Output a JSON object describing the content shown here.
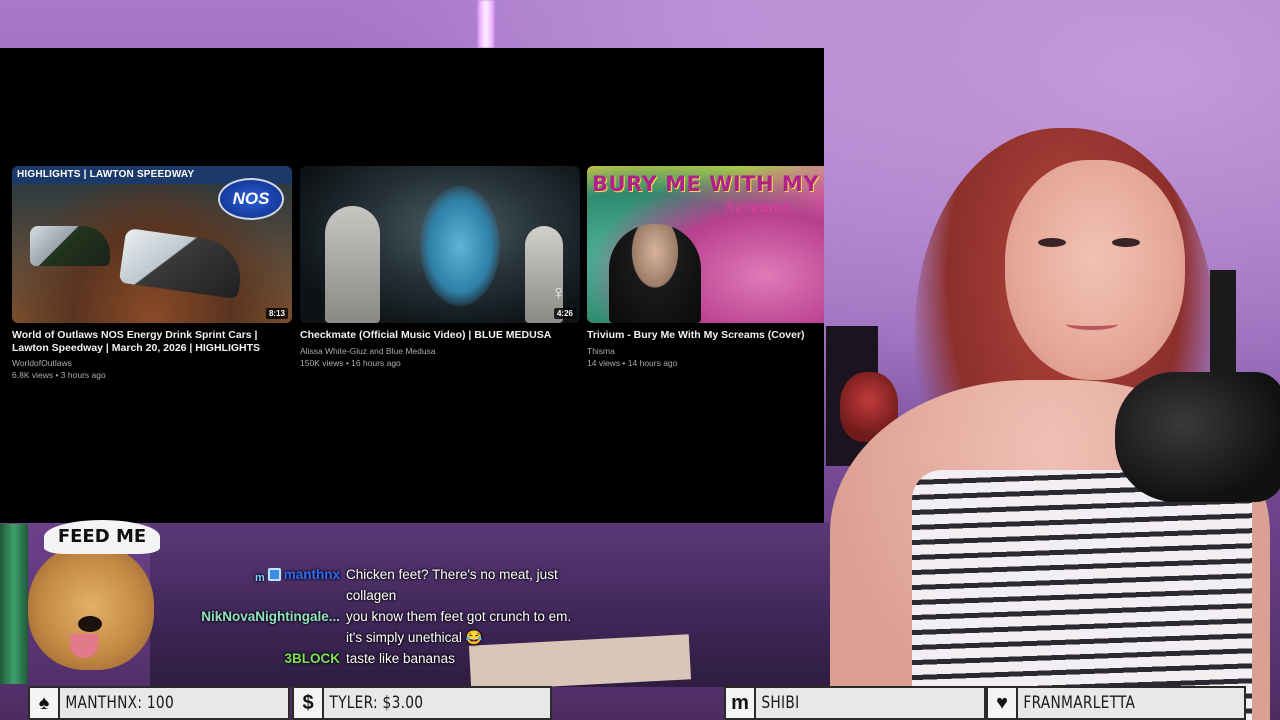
{
  "videos": [
    {
      "banner": "HIGHLIGHTS | LAWTON SPEEDWAY",
      "badge": "NOS",
      "duration": "8:13",
      "title": "World of Outlaws NOS Energy Drink Sprint Cars | Lawton Speedway | March 20, 2026 | HIGHLIGHTS",
      "channel": "WorldofOutlaws",
      "stats": "6.8K views • 3 hours ago"
    },
    {
      "duration": "4:26",
      "title": "Checkmate (Official Music Video) | BLUE MEDUSA",
      "channel": "Alissa White-Gluz and Blue Medusa",
      "stats": "150K views • 16 hours ago"
    },
    {
      "album_title": "BURY ME WITH MY",
      "album_script": "Screams",
      "title": "Trivium - Bury Me With My Screams (Cover)",
      "channel": "Thisma",
      "stats": "14 views • 14 hours ago"
    }
  ],
  "feed_sign": "FEED ME",
  "chat": [
    {
      "user": "manthnx",
      "user_color": "#2f6bff",
      "badges": [
        "m",
        "square"
      ],
      "message": "Chicken feet? There's no meat, just collagen"
    },
    {
      "user": "NikNovaNightingale...",
      "user_color": "#8fe3c0",
      "badges": [],
      "message": "you know them feet got crunch to em. it's simply unethical 😂"
    },
    {
      "user": "3BLOCK",
      "user_color": "#7fe05a",
      "badges": [],
      "message": "taste like bananas"
    }
  ],
  "alerts": [
    {
      "icon": "spade-icon",
      "symbol": "♠",
      "text": "MANTHNX: 100"
    },
    {
      "icon": "dollar-icon",
      "symbol": "$",
      "text": "TYLER: $3.00"
    },
    {
      "icon": "m-icon",
      "symbol": "m",
      "text": "SHIBI"
    },
    {
      "icon": "heart-icon",
      "symbol": "♥",
      "text": "FRANMARLETTA"
    }
  ]
}
